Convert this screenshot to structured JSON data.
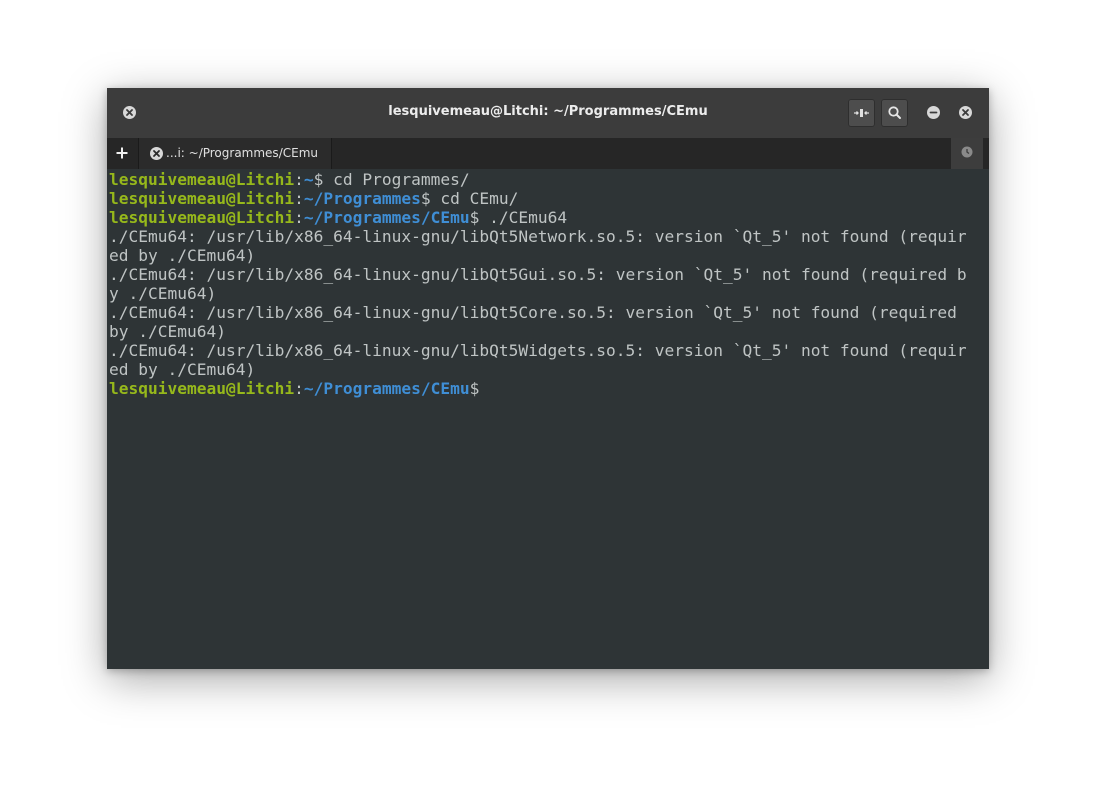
{
  "window": {
    "title": "lesquivemeau@Litchi: ~/Programmes/CEmu"
  },
  "titlebar": {
    "close_icon": "close-icon",
    "split_icon": "split-view-icon",
    "search_icon": "search-icon",
    "minimize_icon": "minimize-icon",
    "close_window_icon": "close-icon"
  },
  "tabs": {
    "new_tab_label": "+",
    "items": [
      {
        "label": "...i: ~/Programmes/CEmu"
      }
    ],
    "history_icon": "history-icon"
  },
  "colors": {
    "background": "#2e3436",
    "user_host": "#96b81b",
    "path": "#3f8ed5",
    "text": "#bfc4c4"
  },
  "terminal": {
    "lines": [
      {
        "type": "prompt",
        "user": "lesquivemeau@Litchi",
        "sep": ":",
        "path": "~",
        "dollar": "$ ",
        "cmd": "cd Programmes/"
      },
      {
        "type": "prompt",
        "user": "lesquivemeau@Litchi",
        "sep": ":",
        "path": "~/Programmes",
        "dollar": "$ ",
        "cmd": "cd CEmu/"
      },
      {
        "type": "prompt",
        "user": "lesquivemeau@Litchi",
        "sep": ":",
        "path": "~/Programmes/CEmu",
        "dollar": "$ ",
        "cmd": "./CEmu64"
      },
      {
        "type": "output",
        "text": "./CEmu64: /usr/lib/x86_64-linux-gnu/libQt5Network.so.5: version `Qt_5' not found (requir"
      },
      {
        "type": "output",
        "text": "ed by ./CEmu64)"
      },
      {
        "type": "output",
        "text": "./CEmu64: /usr/lib/x86_64-linux-gnu/libQt5Gui.so.5: version `Qt_5' not found (required b"
      },
      {
        "type": "output",
        "text": "y ./CEmu64)"
      },
      {
        "type": "output",
        "text": "./CEmu64: /usr/lib/x86_64-linux-gnu/libQt5Core.so.5: version `Qt_5' not found (required "
      },
      {
        "type": "output",
        "text": "by ./CEmu64)"
      },
      {
        "type": "output",
        "text": "./CEmu64: /usr/lib/x86_64-linux-gnu/libQt5Widgets.so.5: version `Qt_5' not found (requir"
      },
      {
        "type": "output",
        "text": "ed by ./CEmu64)"
      },
      {
        "type": "prompt",
        "user": "lesquivemeau@Litchi",
        "sep": ":",
        "path": "~/Programmes/CEmu",
        "dollar": "$",
        "cmd": ""
      }
    ]
  }
}
